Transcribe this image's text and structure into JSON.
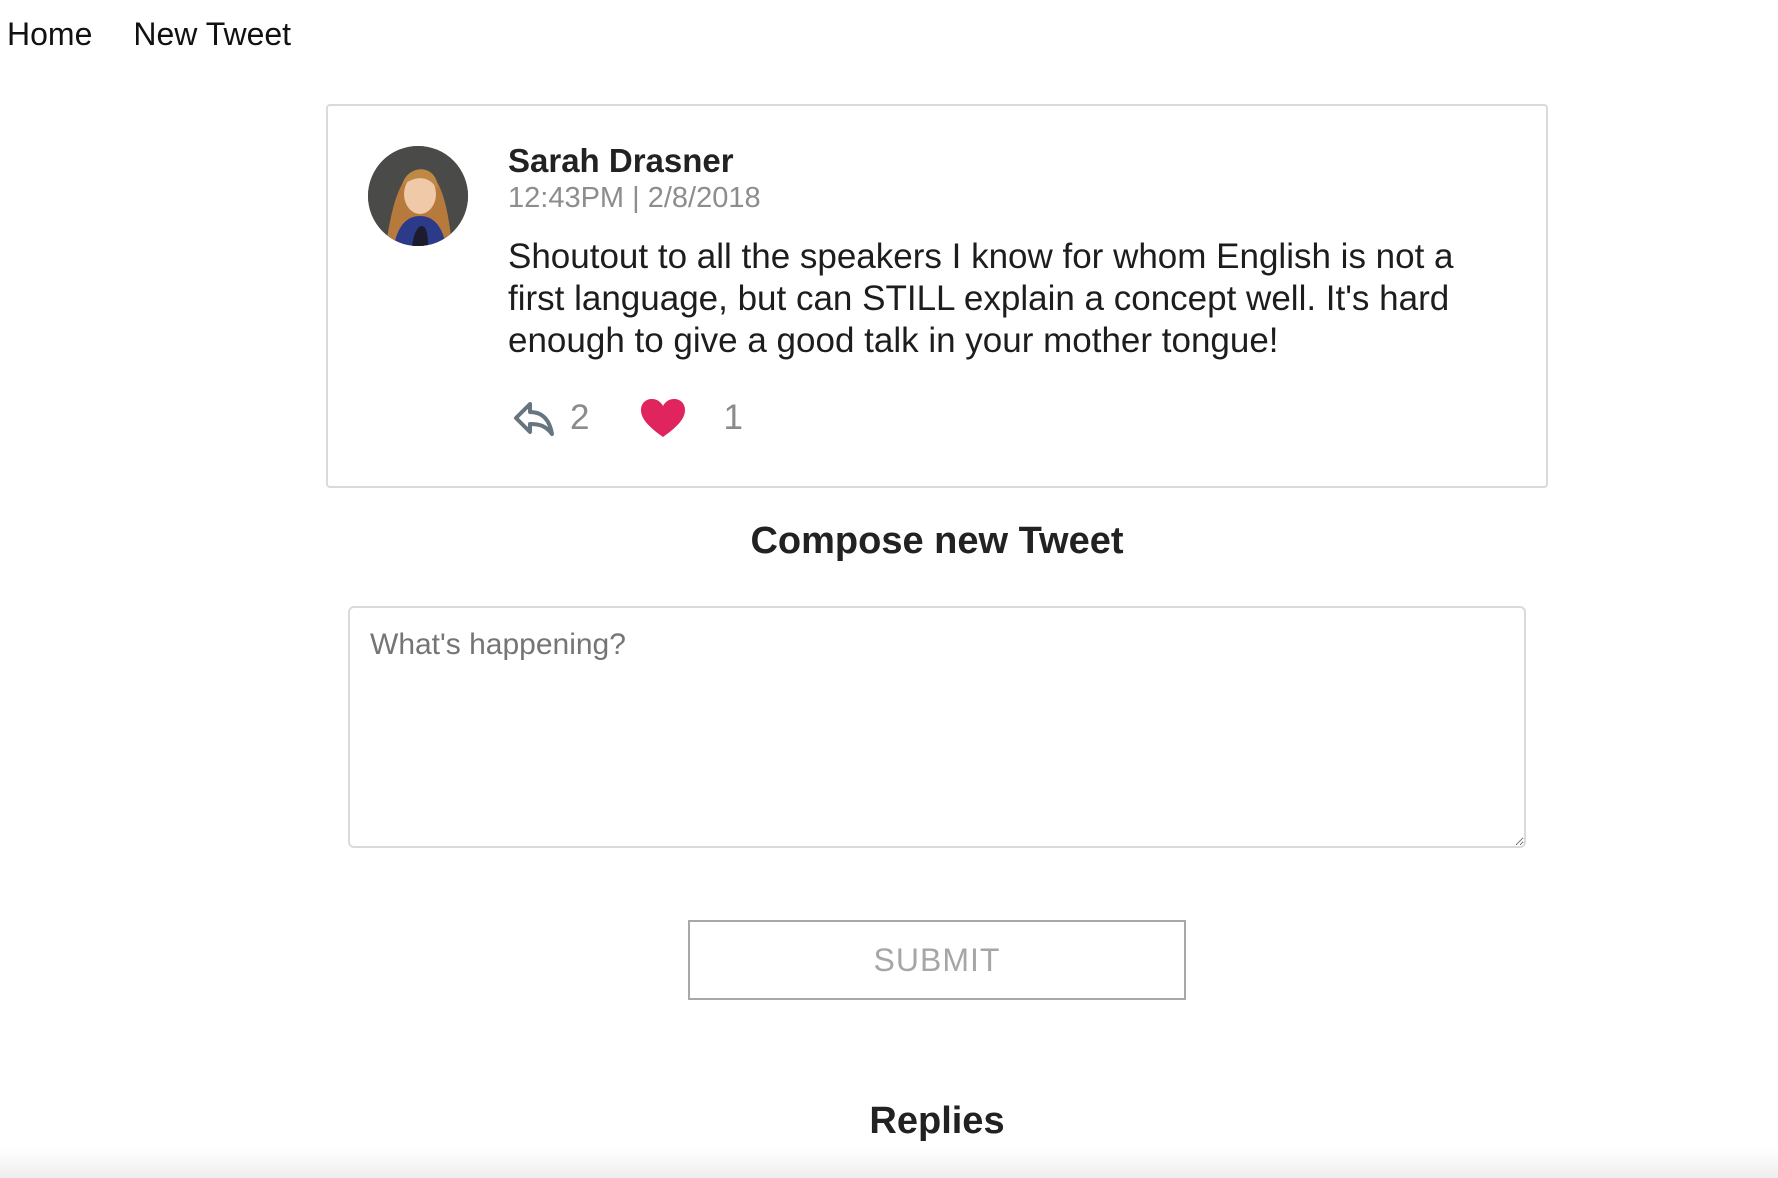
{
  "nav": {
    "home_label": "Home",
    "new_tweet_label": "New Tweet"
  },
  "tweet": {
    "author": "Sarah Drasner",
    "timestamp": "12:43PM | 2/8/2018",
    "text": "Shoutout to all the speakers I know for whom English is not a first language, but can STILL explain a concept well. It's hard enough to give a good talk in your mother tongue!",
    "reply_count": "2",
    "like_count": "1",
    "reply_icon": "reply-arrow-icon",
    "like_icon": "heart-icon",
    "like_color": "#e0245e"
  },
  "compose": {
    "title": "Compose new Tweet",
    "placeholder": "What's happening?",
    "value": "",
    "submit_label": "SUBMIT"
  },
  "replies": {
    "title": "Replies"
  }
}
